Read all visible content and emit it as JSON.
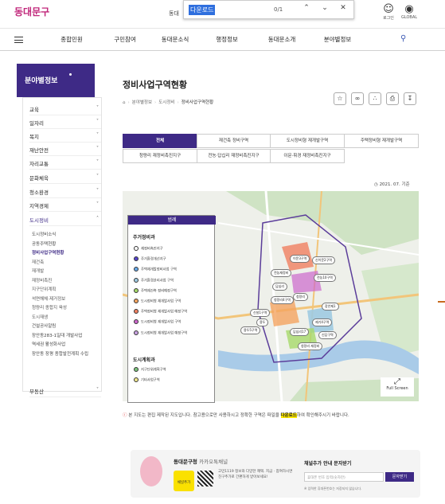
{
  "header": {
    "logo": "동대문구",
    "prefix_text": "동대",
    "login": "로그인",
    "global": "GLOBAL"
  },
  "findbar": {
    "query": "다운로드",
    "count": "0/1"
  },
  "nav": [
    "종합민원",
    "구민참여",
    "동대문소식",
    "행정정보",
    "동대문소개",
    "분야별정보"
  ],
  "sidebar": {
    "title": "분야별정보",
    "items": [
      "교육",
      "일자리",
      "복지",
      "재난안전",
      "자리교통",
      "문화체육",
      "청소환경",
      "지역경제",
      "도시정비",
      "부동산"
    ],
    "subitems": [
      "도시정비소식",
      "공동주택현황",
      "정비사업구역현황",
      "재건축",
      "재개발",
      "재정비촉진",
      "지구단위계획",
      "석면해체·제거정보",
      "청량리 종합지 육성",
      "도시재생",
      "건설공사알림",
      "장안동283-1일대 개발사업",
      "역세권 활성화사업",
      "장안동 장평 종합발전계획 수립"
    ]
  },
  "page": {
    "title": "정비사업구역현황",
    "breadcrumb": [
      "분야별정보",
      "도시정비",
      "정비사업구역현황"
    ]
  },
  "tabs": [
    [
      "전체",
      "재건축 정비구역",
      "도시정비형 재개발구역",
      "주택정비형 재개발구역"
    ],
    [
      "청량리 재정비촉진지구",
      "전농·답십리 재정비촉진지구",
      "이문·휘경 재정비촉진지구"
    ]
  ],
  "date": "2021. 07. 기준",
  "legend": {
    "header": "범례",
    "sec1": "주거정비과",
    "rows1": [
      "재정비촉진지구",
      "주거환경개선지구",
      "주택재개발정비사업 구역",
      "주거환경관리사업 구역",
      "주택재건축 정비예정구역",
      "도시정비형 재개발사업 구역",
      "주택정비형 재개발사업 예정구역",
      "도시정비형 재개발사업 구역",
      "도시정비형 재개발사업 예정구역"
    ],
    "sec2": "도시계획과",
    "rows2": [
      "지구단위계획구역",
      "기타사업구역"
    ],
    "colors1": [
      "#ffffff",
      "#5544cc",
      "#66a8e8",
      "#9ecae1",
      "#a6d96a",
      "#f4a460",
      "#f08060",
      "#cc66cc",
      "#c7a0e0"
    ],
    "colors2": [
      "#7ac47a",
      "#f0e68c"
    ]
  },
  "map_labels": [
    "이문3구역",
    "신이문2구역",
    "전농재정비",
    "전농10구역",
    "답십리",
    "청량리",
    "청량리4구역",
    "장안제1",
    "신설1구역",
    "용두",
    "제기4구역",
    "용두5구역",
    "답십리17",
    "신답구역",
    "청량리 재정비"
  ],
  "fullscreen": "Full Screen",
  "note": {
    "pre": "본 지도는 편집 제작된 지도입니다. 참고용으로만 사용하시고 정확한 구역은 파일을",
    "highlight": "다운로드",
    "post": "하여 확인해주시기 바랍니다."
  },
  "kakao": {
    "channel": "동대문구청",
    "chan_suffix": "카카오톡채널",
    "plus": "채널추가",
    "desc": "고민1119 정보와 다양한 혜택. 지금 · 참여하시면 친구추가로 간편하게 받아보세요!",
    "sms_title": "채널추가 안내 문자받기",
    "sms_placeholder": "휴대폰 번호 입력(숫자만)",
    "sms_btn": "문자받기",
    "sms_note": "※ 입력한 휴대폰번호는 저장되지 않습니다."
  }
}
